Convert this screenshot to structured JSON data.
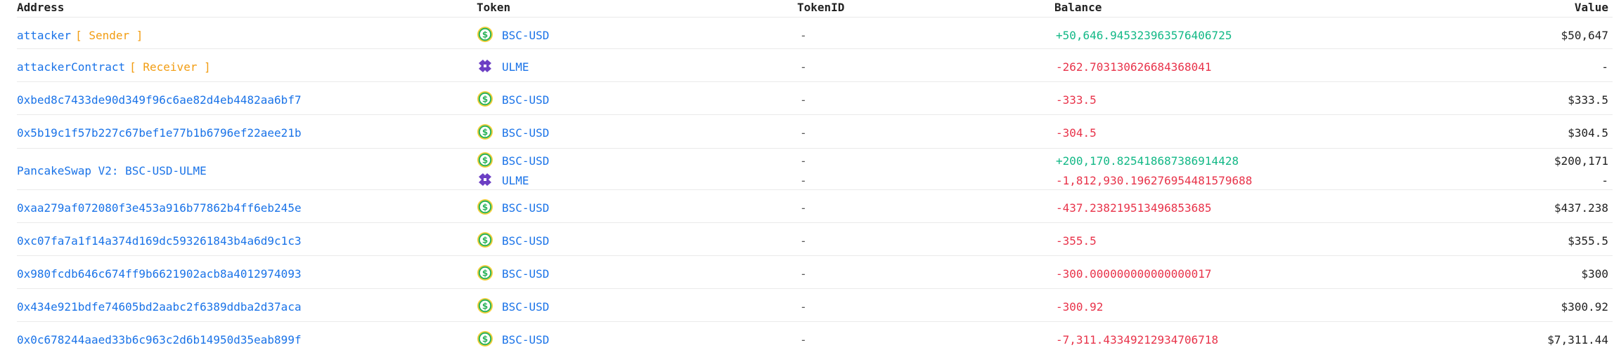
{
  "headers": {
    "address": "Address",
    "token": "Token",
    "tokenid": "TokenID",
    "balance": "Balance",
    "value": "Value"
  },
  "colors": {
    "link": "#1a73e8",
    "tag": "#f29d12",
    "positive": "#12b886",
    "negative": "#e8334a",
    "usd_icon": "#2bb35a",
    "ulme_icon": "#6c3fc4"
  },
  "rows": [
    {
      "address": "attacker",
      "tag": "[ Sender ]",
      "entries": [
        {
          "icon": "usd-coin-icon",
          "token": "BSC-USD",
          "tokenid": "-",
          "balance": "+50,646.945323963576406725",
          "sign": "pos",
          "value": "$50,647"
        }
      ]
    },
    {
      "address": "attackerContract",
      "tag": "[ Receiver ]",
      "entries": [
        {
          "icon": "ulme-token-icon",
          "token": "ULME",
          "tokenid": "-",
          "balance": "-262.703130626684368041",
          "sign": "neg",
          "value": "-"
        }
      ]
    },
    {
      "address": "0xbed8c7433de90d349f96c6ae82d4eb4482aa6bf7",
      "tag": "",
      "entries": [
        {
          "icon": "usd-coin-icon",
          "token": "BSC-USD",
          "tokenid": "-",
          "balance": "-333.5",
          "sign": "neg",
          "value": "$333.5"
        }
      ]
    },
    {
      "address": "0x5b19c1f57b227c67bef1e77b1b6796ef22aee21b",
      "tag": "",
      "entries": [
        {
          "icon": "usd-coin-icon",
          "token": "BSC-USD",
          "tokenid": "-",
          "balance": "-304.5",
          "sign": "neg",
          "value": "$304.5"
        }
      ]
    },
    {
      "address": "PancakeSwap V2: BSC-USD-ULME",
      "tag": "",
      "entries": [
        {
          "icon": "usd-coin-icon",
          "token": "BSC-USD",
          "tokenid": "-",
          "balance": "+200,170.825418687386914428",
          "sign": "pos",
          "value": "$200,171"
        },
        {
          "icon": "ulme-token-icon",
          "token": "ULME",
          "tokenid": "-",
          "balance": "-1,812,930.196276954481579688",
          "sign": "neg",
          "value": "-"
        }
      ]
    },
    {
      "address": "0xaa279af072080f3e453a916b77862b4ff6eb245e",
      "tag": "",
      "entries": [
        {
          "icon": "usd-coin-icon",
          "token": "BSC-USD",
          "tokenid": "-",
          "balance": "-437.238219513496853685",
          "sign": "neg",
          "value": "$437.238"
        }
      ]
    },
    {
      "address": "0xc07fa7a1f14a374d169dc593261843b4a6d9c1c3",
      "tag": "",
      "entries": [
        {
          "icon": "usd-coin-icon",
          "token": "BSC-USD",
          "tokenid": "-",
          "balance": "-355.5",
          "sign": "neg",
          "value": "$355.5"
        }
      ]
    },
    {
      "address": "0x980fcdb646c674ff9b6621902acb8a4012974093",
      "tag": "",
      "entries": [
        {
          "icon": "usd-coin-icon",
          "token": "BSC-USD",
          "tokenid": "-",
          "balance": "-300.000000000000000017",
          "sign": "neg",
          "value": "$300"
        }
      ]
    },
    {
      "address": "0x434e921bdfe74605bd2aabc2f6389ddba2d37aca",
      "tag": "",
      "entries": [
        {
          "icon": "usd-coin-icon",
          "token": "BSC-USD",
          "tokenid": "-",
          "balance": "-300.92",
          "sign": "neg",
          "value": "$300.92"
        }
      ]
    },
    {
      "address": "0x0c678244aaed33b6c963c2d6b14950d35eab899f",
      "tag": "",
      "entries": [
        {
          "icon": "usd-coin-icon",
          "token": "BSC-USD",
          "tokenid": "-",
          "balance": "-7,311.43349212934706718",
          "sign": "neg",
          "value": "$7,311.44"
        }
      ]
    }
  ]
}
